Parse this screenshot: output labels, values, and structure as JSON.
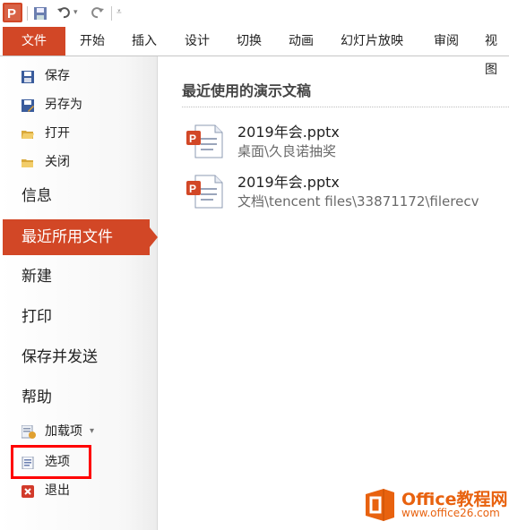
{
  "qat": {
    "app_icon": "powerpoint-icon",
    "save_icon": "save-icon",
    "undo_icon": "undo-icon",
    "redo_icon": "redo-icon",
    "customize_icon": "customize-qat-icon"
  },
  "ribbon": {
    "tabs": [
      "文件",
      "开始",
      "插入",
      "设计",
      "切换",
      "动画",
      "幻灯片放映",
      "审阅",
      "视图"
    ]
  },
  "sidebar": {
    "top_items": [
      {
        "label": "保存",
        "icon": "save-icon"
      },
      {
        "label": "另存为",
        "icon": "save-as-icon"
      },
      {
        "label": "打开",
        "icon": "open-folder-icon"
      },
      {
        "label": "关闭",
        "icon": "close-folder-icon"
      }
    ],
    "info": "信息",
    "recent": "最近所用文件",
    "new": "新建",
    "print": "打印",
    "save_send": "保存并发送",
    "help": "帮助",
    "addins": {
      "label": "加载项",
      "icon": "addins-icon",
      "dropdown": "▾"
    },
    "options": {
      "label": "选项",
      "icon": "options-icon"
    },
    "exit": {
      "label": "退出",
      "icon": "exit-icon"
    }
  },
  "main": {
    "title": "最近使用的演示文稿",
    "files": [
      {
        "name": "2019年会.pptx",
        "path": "桌面\\久良诺抽奖",
        "icon": "pptx-file-icon"
      },
      {
        "name": "2019年会.pptx",
        "path": "文档\\tencent files\\33871172\\filerecv",
        "icon": "pptx-file-icon"
      }
    ]
  },
  "watermark": {
    "line1": "Office教程网",
    "line2": "www.office26.com",
    "icon": "office-logo-icon"
  },
  "colors": {
    "accent": "#d24726",
    "highlight_box": "#ff0000",
    "watermark": "#e8620f"
  }
}
